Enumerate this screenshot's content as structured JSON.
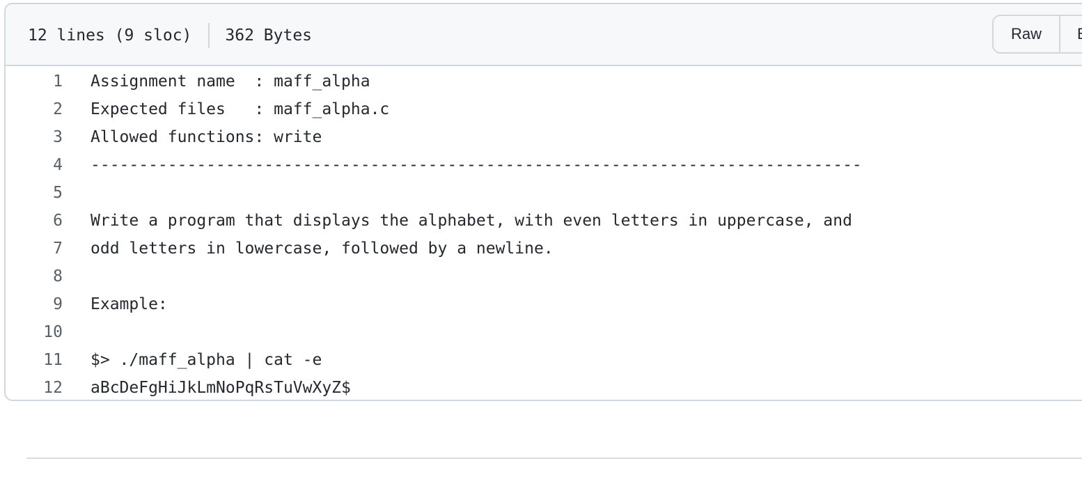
{
  "file": {
    "lines_info": "12 lines (9 sloc)",
    "size_info": "362 Bytes"
  },
  "actions": {
    "raw_label": "Raw",
    "blame_label": "Blame"
  },
  "code": {
    "lines": [
      {
        "num": "1",
        "text": "Assignment name  : maff_alpha"
      },
      {
        "num": "2",
        "text": "Expected files   : maff_alpha.c"
      },
      {
        "num": "3",
        "text": "Allowed functions: write"
      },
      {
        "num": "4",
        "text": "--------------------------------------------------------------------------------"
      },
      {
        "num": "5",
        "text": ""
      },
      {
        "num": "6",
        "text": "Write a program that displays the alphabet, with even letters in uppercase, and"
      },
      {
        "num": "7",
        "text": "odd letters in lowercase, followed by a newline."
      },
      {
        "num": "8",
        "text": ""
      },
      {
        "num": "9",
        "text": "Example:"
      },
      {
        "num": "10",
        "text": ""
      },
      {
        "num": "11",
        "text": "$> ./maff_alpha | cat -e"
      },
      {
        "num": "12",
        "text": "aBcDeFgHiJkLmNoPqRsTuVwXyZ$"
      }
    ]
  }
}
